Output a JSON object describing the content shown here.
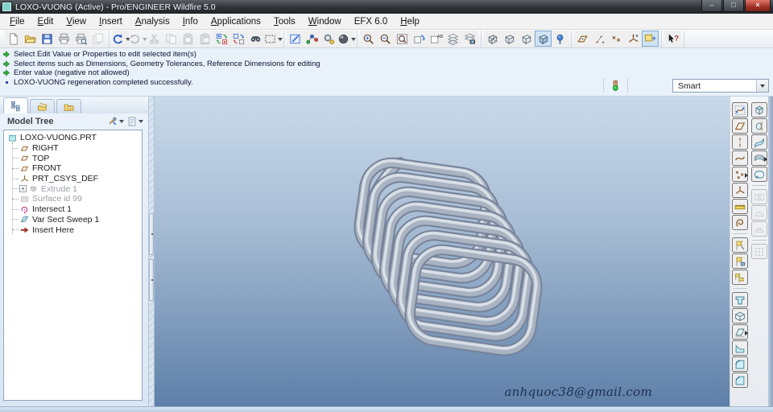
{
  "window": {
    "title": "LOXO-VUONG (Active) - Pro/ENGINEER Wildfire 5.0",
    "controls": [
      {
        "name": "minimize",
        "glyph": "‒"
      },
      {
        "name": "maximize",
        "glyph": "□"
      },
      {
        "name": "close",
        "glyph": "×"
      }
    ]
  },
  "menu": {
    "items": [
      {
        "label": "File",
        "u": 0
      },
      {
        "label": "Edit",
        "u": 0
      },
      {
        "label": "View",
        "u": 0
      },
      {
        "label": "Insert",
        "u": 0
      },
      {
        "label": "Analysis",
        "u": 0
      },
      {
        "label": "Info",
        "u": 0
      },
      {
        "label": "Applications",
        "u": 0
      },
      {
        "label": "Tools",
        "u": 0
      },
      {
        "label": "Window",
        "u": 0
      },
      {
        "label": "EFX 6.0",
        "u": -1
      },
      {
        "label": "Help",
        "u": 0
      }
    ]
  },
  "toolbar": {
    "groups": [
      {
        "items": [
          {
            "name": "new-file"
          },
          {
            "name": "open-file"
          },
          {
            "name": "save"
          },
          {
            "name": "print"
          },
          {
            "name": "print-preview"
          },
          {
            "name": "send-sheets",
            "disabled": true
          }
        ]
      },
      {
        "items": [
          {
            "name": "undo",
            "dropdown": true
          },
          {
            "name": "redo",
            "disabled": true,
            "dropdown": true
          },
          {
            "name": "cut",
            "disabled": true
          },
          {
            "name": "copy",
            "disabled": true
          },
          {
            "name": "paste",
            "disabled": true
          },
          {
            "name": "paste-special",
            "disabled": true
          },
          {
            "name": "regenerate"
          },
          {
            "name": "regen-manager"
          },
          {
            "name": "find"
          },
          {
            "name": "select-box",
            "dropdown": true
          }
        ]
      },
      {
        "items": [
          {
            "name": "repaint"
          },
          {
            "name": "spin-center"
          },
          {
            "name": "orient-mode"
          },
          {
            "name": "appearance",
            "dropdown": true
          }
        ]
      },
      {
        "items": [
          {
            "name": "zoom-in"
          },
          {
            "name": "zoom-out"
          },
          {
            "name": "refit"
          },
          {
            "name": "reorient"
          },
          {
            "name": "saved-views"
          },
          {
            "name": "layers"
          },
          {
            "name": "view-manager"
          }
        ]
      },
      {
        "items": [
          {
            "name": "wireframe"
          },
          {
            "name": "hidden-line"
          },
          {
            "name": "no-hidden"
          },
          {
            "name": "shaded",
            "active": true
          },
          {
            "name": "pin"
          }
        ]
      },
      {
        "items": [
          {
            "name": "tgl-planes"
          },
          {
            "name": "tgl-axes"
          },
          {
            "name": "tgl-points"
          },
          {
            "name": "tgl-csys"
          },
          {
            "name": "tgl-annot",
            "active": true
          }
        ]
      },
      {
        "items": [
          {
            "name": "context-help"
          }
        ]
      }
    ]
  },
  "messages": {
    "lines": [
      {
        "icon": "prompt-arrow",
        "text": "Select Edit Value or Properties to edit selected item(s)"
      },
      {
        "icon": "prompt-arrow",
        "text": "Select items such as Dimensions, Geometry Tolerances, Reference Dimensions for editing"
      },
      {
        "icon": "prompt-arrow",
        "text": "Enter value (negative not allowed)"
      },
      {
        "icon": "info-dot",
        "text": "LOXO-VUONG regeneration completed successfully."
      }
    ]
  },
  "status": {
    "traffic_light_icon": "traffic-light",
    "selection_filter_label": "Smart"
  },
  "model_tree": {
    "tabs": [
      {
        "name": "model-tree-tab",
        "active": true
      },
      {
        "name": "folder-stack-tab",
        "active": false
      },
      {
        "name": "folder-star-tab",
        "active": false
      }
    ],
    "header": {
      "title": "Model Tree",
      "buttons": [
        {
          "name": "tree-settings",
          "dropdown": true
        },
        {
          "name": "tree-display",
          "dropdown": true
        }
      ]
    },
    "nodes": [
      {
        "label": "LOXO-VUONG.PRT",
        "icon": "part",
        "depth": 0
      },
      {
        "label": "RIGHT",
        "icon": "dplane",
        "depth": 1
      },
      {
        "label": "TOP",
        "icon": "dplane",
        "depth": 1
      },
      {
        "label": "FRONT",
        "icon": "dplane",
        "depth": 1
      },
      {
        "label": "PRT_CSYS_DEF",
        "icon": "csys-s",
        "depth": 1
      },
      {
        "label": "Extrude 1",
        "icon": "extrude-s",
        "depth": 1,
        "grayed": true,
        "expandable": true
      },
      {
        "label": "Surface id 99",
        "icon": "surface-s",
        "depth": 1,
        "grayed": true
      },
      {
        "label": "Intersect 1",
        "icon": "intersect-s",
        "depth": 1
      },
      {
        "label": "Var Sect Sweep 1",
        "icon": "vss-s",
        "depth": 1
      },
      {
        "label": "Insert Here",
        "icon": "insert-s",
        "depth": 1
      }
    ]
  },
  "viewport": {
    "watermark": "anhquoc38@gmail.com",
    "model": {
      "shape": "square-coil-spring",
      "turns": 7,
      "tube_color": "#a9b3c1",
      "background_top": "#c9d9e9",
      "background_bottom": "#5e7fa8"
    }
  },
  "right_toolbar": {
    "left_column": [
      {
        "name": "style-tool"
      },
      {
        "name": "datum-plane-tool"
      },
      {
        "name": "datum-axis-tool"
      },
      {
        "name": "datum-curve-tool"
      },
      {
        "name": "datum-point-tool",
        "flyout": true
      },
      {
        "name": "csys-tool"
      },
      {
        "name": "datum-graph-tool"
      },
      {
        "name": "sketch-tool"
      },
      {
        "name": "--"
      },
      {
        "name": "note-flag-tool"
      },
      {
        "name": "note-picture-tool"
      },
      {
        "name": "note-arrange-tool"
      },
      {
        "name": "--"
      },
      {
        "name": "hole-tool"
      },
      {
        "name": "shell-tool"
      },
      {
        "name": "draft-tool",
        "flyout": true
      },
      {
        "name": "rib-tool"
      },
      {
        "name": "round-tool"
      },
      {
        "name": "chamfer-tool"
      }
    ],
    "right_column": [
      {
        "name": "extrude-tool"
      },
      {
        "name": "revolve-tool"
      },
      {
        "name": "sweep-tool"
      },
      {
        "name": "boundary-blend-tool",
        "flyout": true
      },
      {
        "name": "style-surface-tool"
      },
      {
        "name": "--"
      },
      {
        "name": "mirror-tool",
        "disabled": true
      },
      {
        "name": "merge-tool",
        "disabled": true
      },
      {
        "name": "trim-tool",
        "disabled": true
      },
      {
        "name": "--"
      },
      {
        "name": "pattern-tool",
        "disabled": true
      }
    ]
  }
}
